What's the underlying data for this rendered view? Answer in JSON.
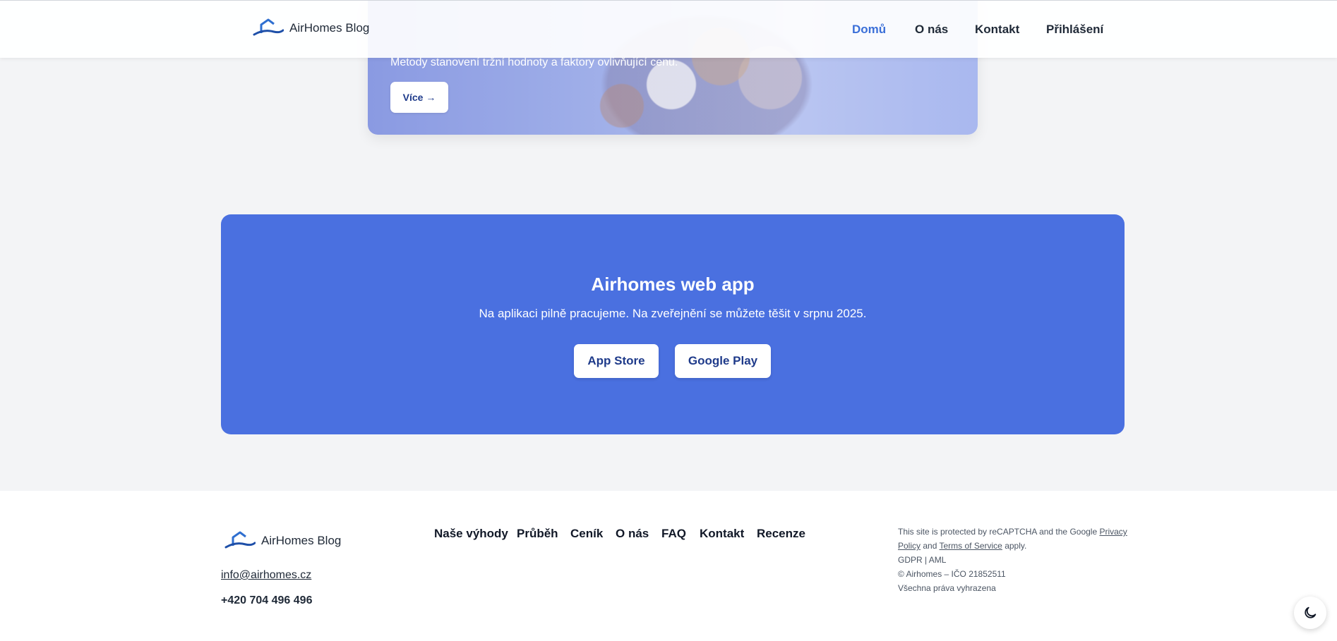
{
  "brand": {
    "name": "AirHomes Blog"
  },
  "nav": {
    "items": [
      {
        "label": "Domů",
        "active": true
      },
      {
        "label": "O nás"
      },
      {
        "label": "Kontakt"
      },
      {
        "label": "Přihlášení"
      }
    ]
  },
  "hero": {
    "subtitle": "Metody stanovení tržní hodnoty a faktory ovlivňující cenu.",
    "more_label": "Více →"
  },
  "promo": {
    "title": "Airhomes web app",
    "text": "Na aplikaci pilně pracujeme. Na zveřejnění se můžete těšit v srpnu 2025.",
    "app_store_label": "App Store",
    "google_play_label": "Google Play"
  },
  "footer": {
    "email": "info@airhomes.cz",
    "phone": "+420 704 496 496",
    "links": [
      "Naše výhody",
      "Průběh",
      "Ceník",
      "O nás",
      "FAQ",
      "Kontakt",
      "Recenze"
    ],
    "legal": {
      "recaptcha_prefix": "This site is protected by reCAPTCHA and the Google ",
      "privacy_policy": "Privacy Policy",
      "and": " and ",
      "terms": "Terms of Service",
      "apply": " apply.",
      "gdpr": "GDPR | AML",
      "copyright": "© Airhomes – IČO 21852511",
      "rights": "Všechna práva vyhrazena"
    }
  },
  "colors": {
    "accent": "#4a70e0",
    "active_nav": "#3b6fd8",
    "button_text": "#1e3a8a",
    "logo_blue": "#2f6fd0"
  },
  "icons": {
    "logo": "house-wave-icon",
    "theme_toggle": "moon-icon"
  }
}
